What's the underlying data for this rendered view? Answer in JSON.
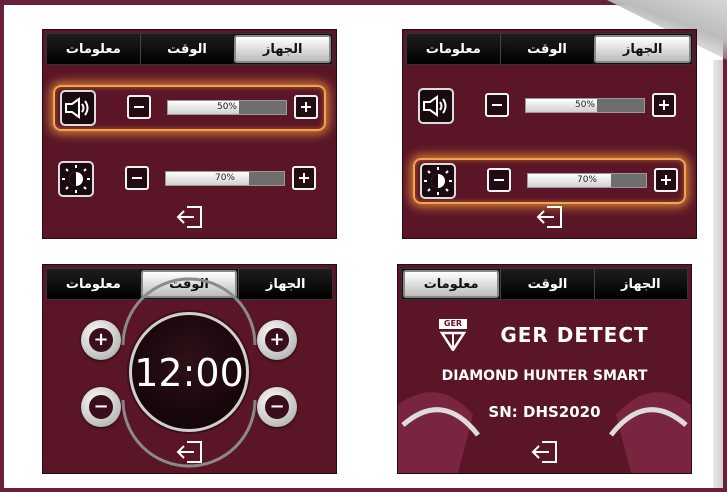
{
  "tabs": {
    "info": "معلومات",
    "time": "الوقت",
    "device": "الجهاز"
  },
  "panels": [
    {
      "id": "sound-panel",
      "active_tab": "device",
      "highlight": "volume",
      "volume_label": "50%",
      "volume": 0.5,
      "brightness_label": "70%",
      "brightness": 0.7
    },
    {
      "id": "brightness-panel",
      "active_tab": "device",
      "highlight": "brightness",
      "volume_label": "50%",
      "volume": 0.5,
      "brightness_label": "70%",
      "brightness": 0.7
    },
    {
      "id": "time-panel",
      "active_tab": "time",
      "clock": "12:00"
    },
    {
      "id": "info-panel",
      "active_tab": "info",
      "brand_short": "GER",
      "brand_name": "GER DETECT",
      "product": "DIAMOND HUNTER SMART",
      "serial": "SN: DHS2020"
    }
  ],
  "icons": [
    "speaker-icon",
    "brightness-icon",
    "plus-icon",
    "minus-icon",
    "exit-icon",
    "logo-icon"
  ],
  "colors": {
    "panel_bg": "#5a1627",
    "highlight": "#f0a74a",
    "frame": "#6a1f3a",
    "tab_active": "#e0e0e0"
  }
}
